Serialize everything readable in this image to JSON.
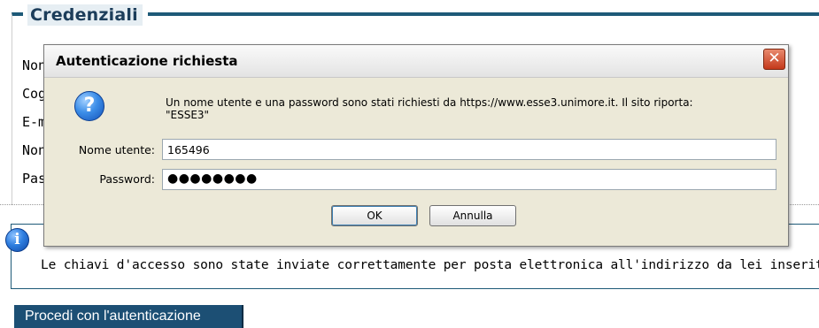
{
  "page": {
    "legend": "Credenziali",
    "rows": [
      "Non",
      "Cog",
      "E-m",
      "Non",
      "Pas"
    ],
    "info_icon": "info-icon",
    "info_text": "Le chiavi d'accesso sono state inviate correttamente per posta elettronica all'indirizzo da lei inserito.",
    "proceed_label": "Procedi con l'autenticazione"
  },
  "dialog": {
    "title": "Autenticazione richiesta",
    "close_label": "✕",
    "question_icon": "question-icon",
    "message_line1": "Un nome utente e una password sono stati richiesti da https://www.esse3.unimore.it. Il sito riporta:",
    "message_line2": "\"ESSE3\"",
    "username_label": "Nome utente:",
    "username_value": "165496",
    "password_label": "Password:",
    "password_value": "●●●●●●●●",
    "ok_label": "OK",
    "cancel_label": "Annulla"
  },
  "colors": {
    "accent": "#1e5a78",
    "proceed_bg": "#1c4f74",
    "dialog_bg": "#ece9d8",
    "close_red": "#c4391b"
  }
}
